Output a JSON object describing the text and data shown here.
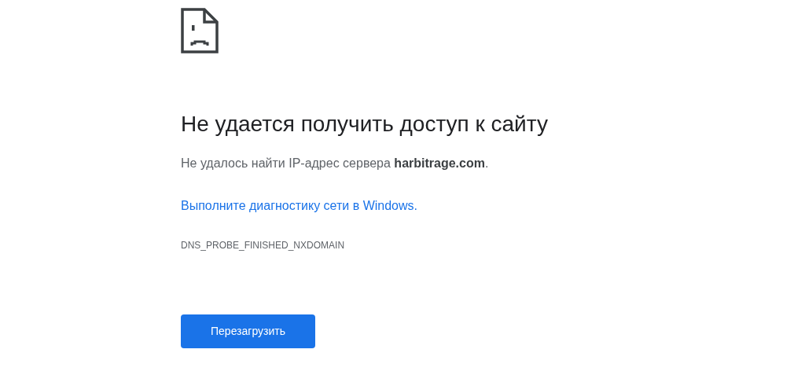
{
  "heading": "Не удается получить доступ к сайту",
  "message": "Не удалось найти IP-адрес сервера **harbitrage.com**.",
  "diagnostics_link": "Выполните диагностику сети в Windows.",
  "error_code": "DNS_PROBE_FINISHED_NXDOMAIN",
  "buttons": [
    {
      "label": "Перезагрузить",
      "kind": "primary"
    }
  ]
}
